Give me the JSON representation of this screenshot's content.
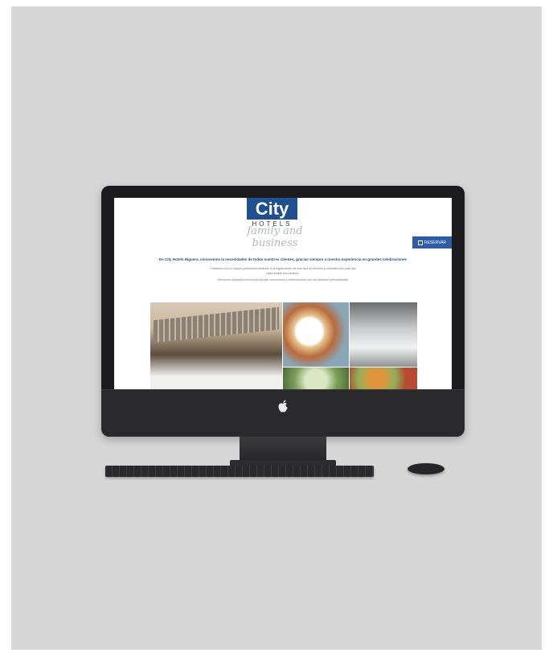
{
  "site": {
    "logo_main": "City",
    "logo_sub": "HOTELS",
    "tagline": "family and business",
    "reserve_button": "RESERVAR",
    "intro_title": "En City Hotels Higuera, conocemos la necesidades de todos nuestros clientes, gracias siempre a nuestra experiencia en grandes celebraciones",
    "intro_lines": [
      "Contamos con un equipo profesional dedicado a la organización de todo tipo de eventos y celebraciones para que",
      "cada detalle sea perfecto.",
      "Ofrecemos espacios únicos para bodas, comuniones y celebraciones con una atención personalizada."
    ],
    "gallery": [
      "terrace-photo",
      "food-photo",
      "banquet-hall-photo",
      "salad-photo",
      "dish-photo"
    ]
  },
  "colors": {
    "brand_blue": "#1e4f91",
    "button_blue": "#2d5da6",
    "backdrop": "#d6d6d6",
    "device": "#1c1c1e"
  },
  "icons": [
    "apple-logo-icon",
    "calendar-icon"
  ]
}
